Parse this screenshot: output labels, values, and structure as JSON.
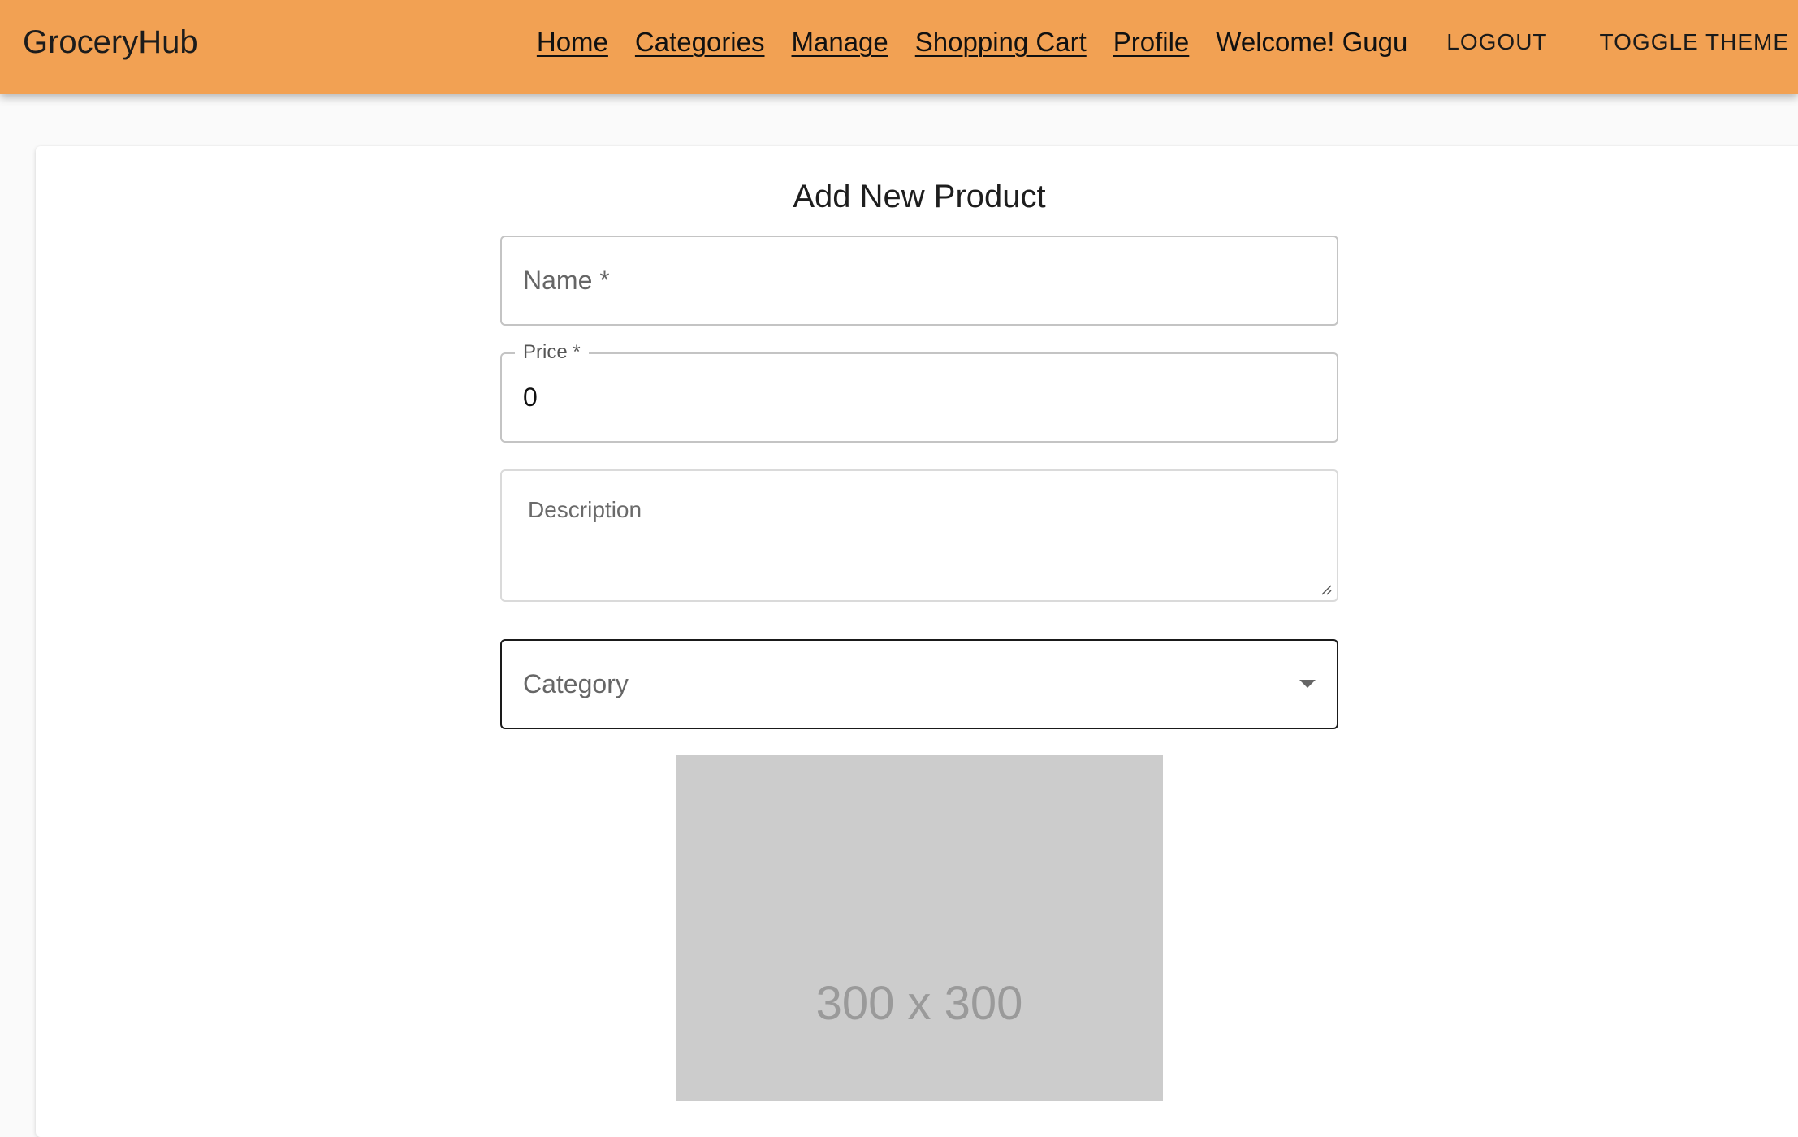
{
  "app": {
    "brand": "GroceryHub"
  },
  "nav": {
    "links": [
      "Home",
      "Categories",
      "Manage",
      "Shopping Cart",
      "Profile"
    ],
    "welcome": "Welcome! Gugu",
    "logout_label": "LOGOUT",
    "toggle_theme_label": "TOGGLE THEME"
  },
  "form": {
    "title": "Add New Product",
    "name": {
      "placeholder": "Name *",
      "value": ""
    },
    "price": {
      "label": "Price *",
      "value": "0"
    },
    "description": {
      "placeholder": "Description",
      "value": ""
    },
    "category": {
      "placeholder": "Category",
      "value": ""
    },
    "image_placeholder": "300 x 300"
  },
  "icons": {
    "category_dropdown": "caret-down-icon",
    "description_resize": "resize-handle-icon"
  }
}
